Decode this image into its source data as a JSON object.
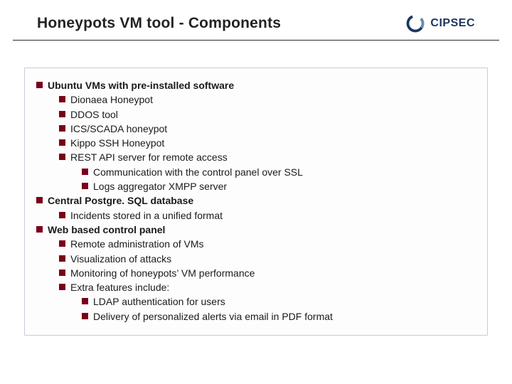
{
  "header": {
    "title": "Honeypots VM tool - Components",
    "logo_text": "CIPSEC"
  },
  "sections": [
    {
      "label": "Ubuntu VMs with pre-installed software",
      "children": [
        {
          "label": "Dionaea Honeypot"
        },
        {
          "label": "DDOS tool"
        },
        {
          "label": "ICS/SCADA honeypot"
        },
        {
          "label": "Kippo SSH Honeypot"
        },
        {
          "label": "REST API server for remote access",
          "children": [
            {
              "label": "Communication with the control panel over SSL"
            },
            {
              "label": "Logs aggregator XMPP server"
            }
          ]
        }
      ]
    },
    {
      "label": "Central Postgre. SQL database",
      "children": [
        {
          "label": "Incidents stored in a unified format"
        }
      ]
    },
    {
      "label": "Web based control panel",
      "children": [
        {
          "label": "Remote administration of VMs"
        },
        {
          "label": "Visualization of attacks"
        },
        {
          "label": "Monitoring of honeypots’ VM performance"
        },
        {
          "label": "Extra features include:",
          "children": [
            {
              "label": "LDAP authentication for users"
            },
            {
              "label": "Delivery of personalized alerts via email in PDF format"
            }
          ]
        }
      ]
    }
  ]
}
